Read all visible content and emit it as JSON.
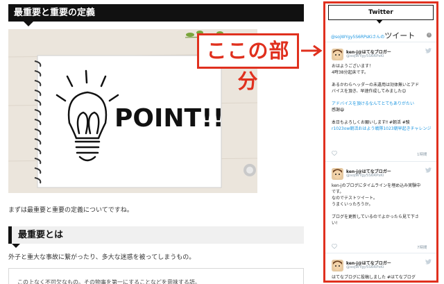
{
  "article": {
    "section_title": "最重要と重要の定義",
    "hero_point_text": "POINT!!",
    "intro": "まずは最重要と重要の定義についてですね。",
    "h2": "最重要とは",
    "paragraph": "外子と重大な事故に繋がったり、多大な迷惑を被ってしまうもの。",
    "quote": "この上なく不可欠なもの。その物事を第一にすることなどを意味する語。"
  },
  "callout": {
    "text": "ここの部分",
    "color": "#e0301e"
  },
  "widget": {
    "header": "Twitter",
    "title_handle": "@sojWYgy5S6RPsKiさんの",
    "title_suffix": "ツイート",
    "info_symbol": "i",
    "tweets": [
      {
        "author": "ken-j@はてなブロガー",
        "handle": "@sojWYgy5S6RPsKi",
        "lines": [
          {
            "text": "おはようございます！"
          },
          {
            "text": "4時38分起床です。"
          },
          {
            "text": ""
          },
          {
            "text": "あるかわらヘッダーの未違用は効体無いとアド"
          },
          {
            "text": "バイスを頂き、早速作成してみました😊"
          },
          {
            "text": ""
          },
          {
            "text": "アドバイスを頂けるなんてとてもありがたい"
          },
          {
            "text": "感謝😆"
          },
          {
            "text": ""
          },
          {
            "text": "本日もよろしくお願いします‼ #朝活 #駿"
          },
          {
            "text": "r1023ow朝活おはよう戦隊1023朝早起きチャレンジ",
            "link": true
          }
        ],
        "time": "1時間"
      },
      {
        "author": "ken-j@はてなブロガー",
        "handle": "@sojWYgy5S6RPsKi",
        "lines": [
          {
            "text": "ken-jのブログにタイムラインを埋め込み実験中"
          },
          {
            "text": "です。"
          },
          {
            "text": "なのでテストツイート。"
          },
          {
            "text": "うまくいったろうか。"
          },
          {
            "text": ""
          },
          {
            "text": "ブログを更新しているのでよかったら見て下さ"
          },
          {
            "text": "い!"
          }
        ],
        "time": "7時間"
      },
      {
        "author": "ken-j@はてなブロガー",
        "handle": "@sojWYgy5S6RPsKi",
        "lines": [
          {
            "text": "はてなブログに投稿しました #はてなブログ"
          }
        ],
        "time": ""
      }
    ]
  }
}
